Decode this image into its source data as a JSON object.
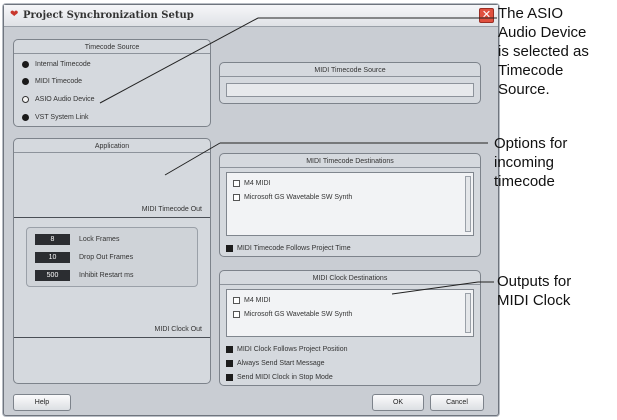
{
  "window": {
    "title": "Project Synchronization Setup",
    "close_glyph": "✕"
  },
  "timecode_source": {
    "title": "Timecode Source",
    "options": [
      {
        "label": "Internal Timecode",
        "selected": false
      },
      {
        "label": "MIDI Timecode",
        "selected": false
      },
      {
        "label": "ASIO Audio Device",
        "selected": true
      },
      {
        "label": "VST System Link",
        "selected": false
      }
    ]
  },
  "midi_timecode_source": {
    "title": "MIDI Timecode Source",
    "value": ""
  },
  "application": {
    "title": "Application",
    "midi_timecode_out": "MIDI Timecode Out",
    "midi_clock_out": "MIDI Clock Out",
    "fields": [
      {
        "value": "8",
        "label": "Lock Frames"
      },
      {
        "value": "10",
        "label": "Drop Out Frames"
      },
      {
        "value": "500",
        "label": "Inhibit Restart ms"
      }
    ]
  },
  "midi_timecode_destinations": {
    "title": "MIDI Timecode Destinations",
    "items": [
      "M4 MIDI",
      "Microsoft GS Wavetable SW Synth"
    ],
    "option": "MIDI Timecode Follows Project Time"
  },
  "midi_clock_destinations": {
    "title": "MIDI Clock Destinations",
    "items": [
      "M4 MIDI",
      "Microsoft GS Wavetable SW Synth"
    ],
    "options": [
      "MIDI Clock Follows Project Position",
      "Always Send Start Message",
      "Send MIDI Clock in Stop Mode"
    ]
  },
  "buttons": {
    "help": "Help",
    "ok": "OK",
    "cancel": "Cancel"
  },
  "annotations": {
    "asio": "The ASIO\nAudio Device\nis selected as\nTimecode\nSource.",
    "options": "Options for\nincoming\ntimecode",
    "outputs": "Outputs for\nMIDI Clock"
  },
  "colors": {
    "dialog_bg": "#c9cdd3",
    "panel_bg": "#d5d9de",
    "close_red": "#e0503f",
    "field_dark": "#2b2d31"
  }
}
